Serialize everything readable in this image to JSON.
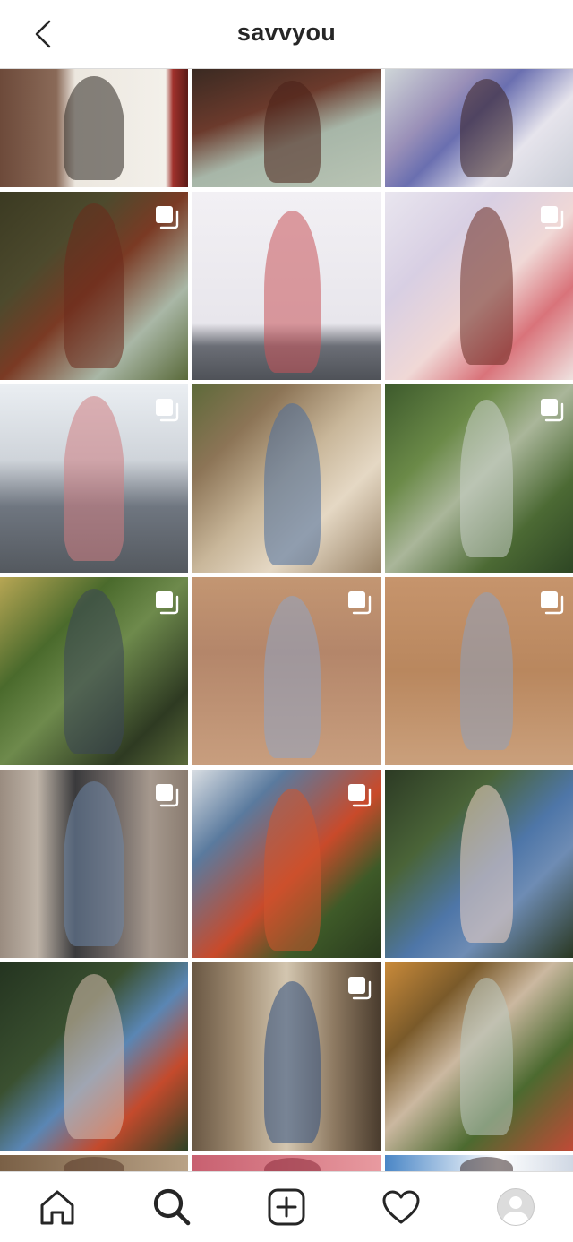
{
  "header": {
    "title": "savvyou",
    "back_icon": "chevron-left-icon"
  },
  "grid": {
    "posts": [
      {
        "bg": "linear-gradient(90deg,#6d4a3a 0%,#8a6a58 30%,#ece7df 40%,#f3f0ea 88%,#a0322c 92%,#5b1a16 100%)",
        "fig": "#2b2620",
        "multi": false
      },
      {
        "bg": "linear-gradient(160deg,#3a2a22 0%,#6b3a2c 35%,#a7b6a8 60%,#b9c4b4 100%)",
        "fig": "#4a2018",
        "multi": false
      },
      {
        "bg": "linear-gradient(135deg,#cfd6d8 0%,#9a90b8 30%,#6a6fb0 45%,#e6e4ec 70%,#c9cdd6 100%)",
        "fig": "#3a2020",
        "multi": false
      },
      {
        "bg": "linear-gradient(135deg,#3b3a22 0%,#4d4a2d 30%,#7a3a24 50%,#a9b7a6 75%,#5a6a3a 100%)",
        "fig": "#6b2a1c",
        "multi": true
      },
      {
        "bg": "linear-gradient(180deg,#f2f0f4 0%,#e8e6ec 70%,#6b6e76 82%,#4f5258 100%)",
        "fig": "#c9545a",
        "multi": false
      },
      {
        "bg": "linear-gradient(135deg,#e9e6ef 0%,#d8cfe3 30%,#f0d8d6 55%,#d9737a 75%,#efe2e0 100%)",
        "fig": "#6a2a20",
        "multi": true
      },
      {
        "bg": "linear-gradient(180deg,#eaeef2 0%,#cfd4da 40%,#6f7680 65%,#54595f 100%)",
        "fig": "#d07e82",
        "multi": true
      },
      {
        "bg": "linear-gradient(135deg,#5e6a3a 0%,#8c7456 25%,#c9b79a 50%,#e5d8c4 70%,#9a8468 100%)",
        "fig": "#4a6e9c",
        "multi": false
      },
      {
        "bg": "linear-gradient(135deg,#3d5a2c 0%,#6b8a48 30%,#aab69a 50%,#4c6a34 75%,#2e4624 100%)",
        "fig": "#c9cfc8",
        "multi": true
      },
      {
        "bg": "linear-gradient(135deg,#b7a654 0%,#4a6a2c 30%,#6e8a4c 50%,#2e3a22 80%,#5a6a3a 100%)",
        "fig": "#3a4658",
        "multi": true
      },
      {
        "bg": "linear-gradient(180deg,#c39672 0%,#b4866a 40%,#c89e7e 100%)",
        "fig": "#8fa4c2",
        "multi": true
      },
      {
        "bg": "linear-gradient(180deg,#c6946c 0%,#b9875e 50%,#caa07c 100%)",
        "fig": "#8ea0bc",
        "multi": true
      },
      {
        "bg": "linear-gradient(90deg,#9a8c80 0%,#bfb4a8 20%,#3a3a3c 40%,#6b6462 60%,#a6998e 80%,#8a7c70 100%)",
        "fig": "#6e86a8",
        "multi": true
      },
      {
        "bg": "linear-gradient(135deg,#d8dde2 0%,#5a7a9e 25%,#c94a2a 55%,#3e5a28 75%,#2a3a1e 100%)",
        "fig": "#d0562e",
        "multi": true
      },
      {
        "bg": "linear-gradient(135deg,#2c3a24 0%,#4a6438 30%,#4e76a8 55%,#6e8cb4 70%,#2a3822 100%)",
        "fig": "#f0d4c4",
        "multi": false
      },
      {
        "bg": "linear-gradient(135deg,#243420 0%,#3a5030 35%,#5a86b4 55%,#c44a2c 75%,#2e4226 100%)",
        "fig": "#d9c0b0",
        "multi": false
      },
      {
        "bg": "linear-gradient(90deg,#6a5844 0%,#a08c72 25%,#d3c6b0 50%,#8e7a62 75%,#4a3c2e 100%)",
        "fig": "#2e4e80",
        "multi": true
      },
      {
        "bg": "linear-gradient(135deg,#c98a3a 0%,#7a5a2a 25%,#cbb8a0 45%,#4c6a30 70%,#c04a36 100%)",
        "fig": "#b9c8c0",
        "multi": false
      },
      {
        "bg": "linear-gradient(90deg,#7a6046 0%,#b9a286 100%)",
        "fig": "#5a3a2a",
        "multi": false
      },
      {
        "bg": "linear-gradient(90deg,#c86070 0%,#e89aa0 100%)",
        "fig": "#8a2a3a",
        "multi": false
      },
      {
        "bg": "linear-gradient(90deg,#4a86c6 0%,#ffffff 60%,#d0d8e4 100%)",
        "fig": "#3a2a2a",
        "multi": false
      }
    ]
  },
  "nav": {
    "items": [
      {
        "name": "home",
        "icon": "home-icon"
      },
      {
        "name": "search",
        "icon": "search-icon"
      },
      {
        "name": "new-post",
        "icon": "plus-square-icon"
      },
      {
        "name": "activity",
        "icon": "heart-icon"
      },
      {
        "name": "profile",
        "icon": "avatar-icon"
      }
    ]
  }
}
